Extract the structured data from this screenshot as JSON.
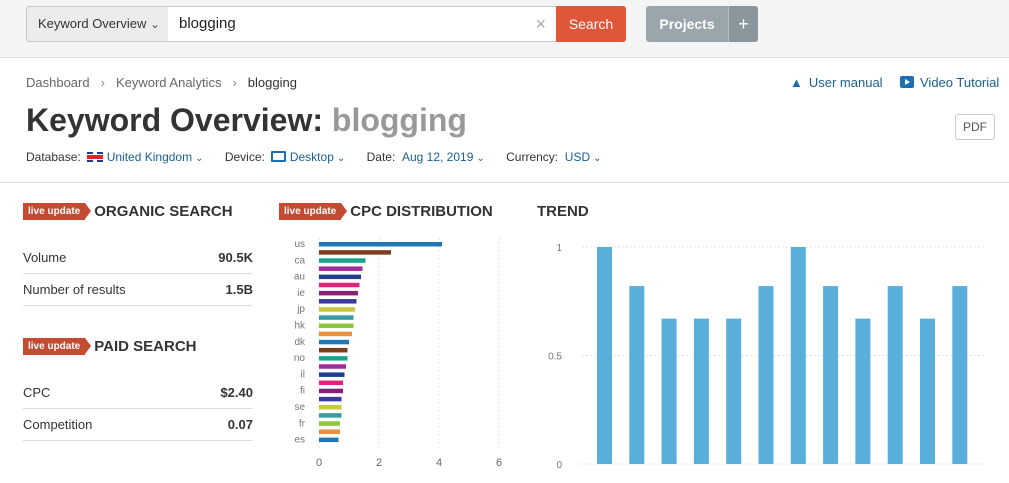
{
  "search": {
    "db_label": "Keyword Overview",
    "query": "blogging",
    "clear_glyph": "×",
    "button": "Search",
    "projects": "Projects",
    "plus": "+"
  },
  "breadcrumb": [
    "Dashboard",
    "Keyword Analytics",
    "blogging"
  ],
  "breadcrumb_sep": "›",
  "help": {
    "manual": "User manual",
    "video": "Video Tutorial"
  },
  "title": {
    "prefix": "Keyword Overview:",
    "keyword": "blogging"
  },
  "pdf": "PDF",
  "filters": {
    "database_label": "Database:",
    "database": "United Kingdom",
    "device_label": "Device:",
    "device": "Desktop",
    "date_label": "Date:",
    "date": "Aug 12, 2019",
    "currency_label": "Currency:",
    "currency": "USD"
  },
  "badge": "live update",
  "organic": {
    "title": "ORGANIC SEARCH",
    "rows": [
      {
        "label": "Volume",
        "value": "90.5K"
      },
      {
        "label": "Number of results",
        "value": "1.5B"
      }
    ]
  },
  "paid": {
    "title": "PAID SEARCH",
    "rows": [
      {
        "label": "CPC",
        "value": "$2.40"
      },
      {
        "label": "Competition",
        "value": "0.07"
      }
    ]
  },
  "cpc_title": "CPC DISTRIBUTION",
  "trend_title": "TREND",
  "colors": {
    "accent": "#e05638",
    "badge": "#c54a32",
    "link": "#1b5f8f",
    "trend_bar": "#5aaedc"
  },
  "chart_data": [
    {
      "type": "bar",
      "orientation": "horizontal",
      "categories": [
        "us",
        "",
        "ca",
        "",
        "au",
        "",
        "ie",
        "",
        "jp",
        "",
        "hk",
        "",
        "dk",
        "",
        "no",
        "",
        "il",
        "",
        "fi",
        "",
        "se",
        "",
        "fr",
        "",
        "es"
      ],
      "values": [
        4.1,
        2.4,
        1.55,
        1.45,
        1.4,
        1.35,
        1.3,
        1.25,
        1.2,
        1.15,
        1.15,
        1.1,
        1.0,
        0.95,
        0.95,
        0.9,
        0.85,
        0.8,
        0.8,
        0.75,
        0.75,
        0.75,
        0.7,
        0.7,
        0.65
      ],
      "bar_colors": [
        "#1f78b4",
        "#7b3f1e",
        "#19a58a",
        "#a52a9b",
        "#1f3d8a",
        "#e0247a",
        "#8a1f7a",
        "#3a3a9a",
        "#c8c83a",
        "#3a9aa5",
        "#8ac83a",
        "#e8903a",
        "#1f78b4",
        "#7b3f1e",
        "#19a58a",
        "#a52a9b",
        "#1f3d8a",
        "#e0247a",
        "#8a1f7a",
        "#3a3a9a",
        "#c8c83a",
        "#3a9aa5",
        "#8ac83a",
        "#e8903a",
        "#1f78b4"
      ],
      "xlim": [
        0,
        6
      ],
      "xticks": [
        0,
        2,
        4,
        6
      ],
      "grid": true
    },
    {
      "type": "bar",
      "values": [
        1,
        0.82,
        0.67,
        0.67,
        0.67,
        0.82,
        1,
        0.82,
        0.67,
        0.82,
        0.67,
        0.82
      ],
      "ylim": [
        0,
        1
      ],
      "yticks": [
        0,
        0.5,
        1
      ],
      "grid": true
    }
  ]
}
